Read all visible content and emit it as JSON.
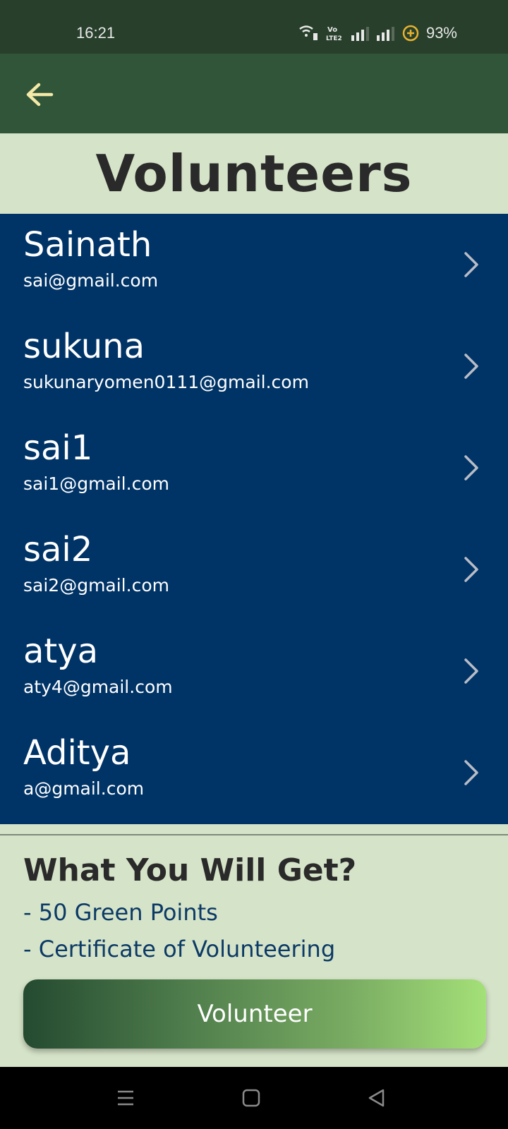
{
  "status_bar": {
    "time": "16:21",
    "battery": "93%",
    "icons": [
      "wifi-call-icon",
      "volte-icon",
      "signal-icon-1",
      "signal-icon-2",
      "battery-saver-icon"
    ]
  },
  "header": {
    "back_icon": "arrow-left-icon",
    "title": "Volunteers"
  },
  "volunteers": [
    {
      "name": "Sainath",
      "email": "sai@gmail.com"
    },
    {
      "name": "sukuna",
      "email": "sukunaryomen0111@gmail.com"
    },
    {
      "name": "sai1",
      "email": "sai1@gmail.com"
    },
    {
      "name": "sai2",
      "email": "sai2@gmail.com"
    },
    {
      "name": "atya",
      "email": "aty4@gmail.com"
    },
    {
      "name": "Aditya",
      "email": "a@gmail.com"
    }
  ],
  "benefits": {
    "title": "What You Will Get?",
    "items": [
      "- 50 Green Points",
      "- Certificate of Volunteering"
    ]
  },
  "cta": {
    "label": "Volunteer"
  },
  "nav": {
    "icons": [
      "menu-icon",
      "home-square-icon",
      "back-triangle-icon"
    ]
  },
  "colors": {
    "status_bar": "#273f2b",
    "app_bar": "#315538",
    "list_bg": "#003366",
    "page_bg": "#d5e3c8",
    "accent_arrow": "#f4e9a8"
  }
}
